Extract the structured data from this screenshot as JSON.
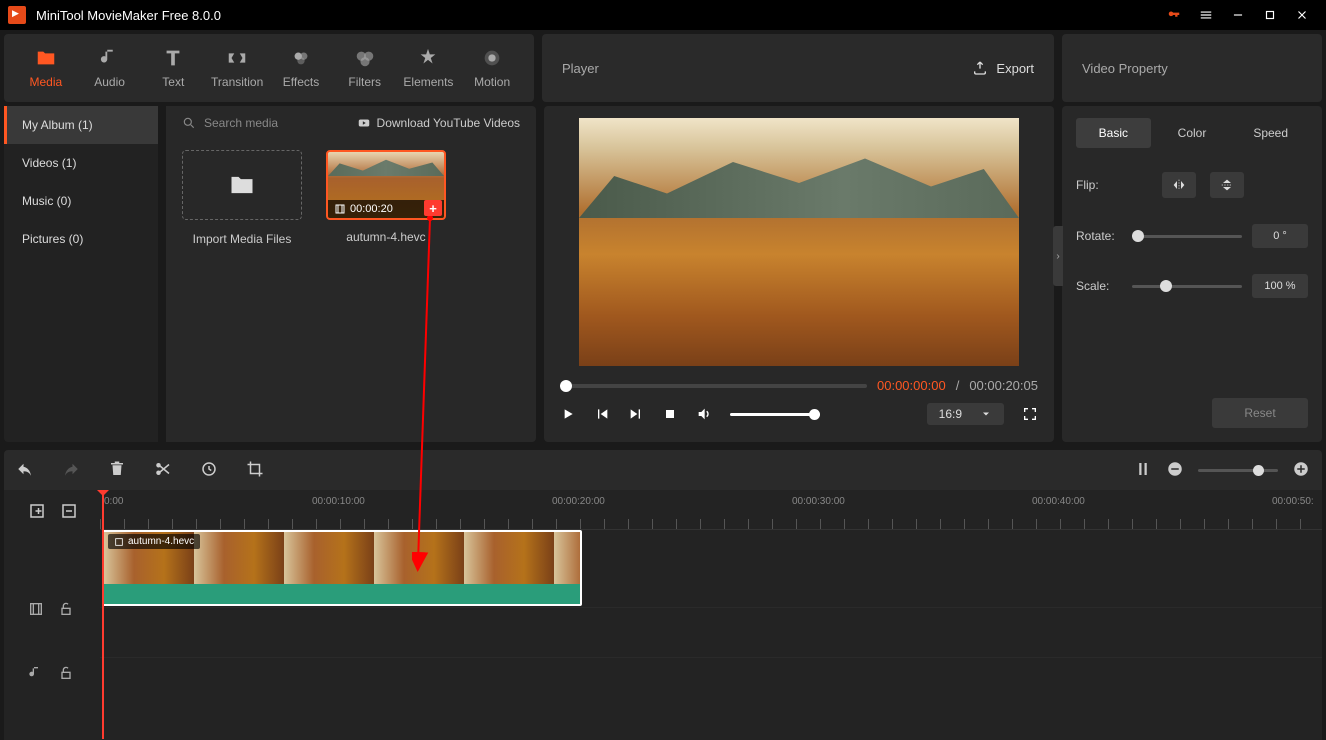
{
  "app": {
    "title": "MiniTool MovieMaker Free 8.0.0"
  },
  "tooltabs": {
    "media": "Media",
    "audio": "Audio",
    "text": "Text",
    "transition": "Transition",
    "effects": "Effects",
    "filters": "Filters",
    "elements": "Elements",
    "motion": "Motion"
  },
  "player": {
    "label": "Player",
    "export": "Export"
  },
  "prop": {
    "label": "Video Property"
  },
  "sidebar": {
    "my_album": "My Album (1)",
    "videos": "Videos (1)",
    "music": "Music (0)",
    "pictures": "Pictures (0)"
  },
  "media": {
    "search_placeholder": "Search media",
    "download": "Download YouTube Videos",
    "import_label": "Import Media Files",
    "clip": {
      "duration": "00:00:20",
      "name": "autumn-4.hevc"
    }
  },
  "playback": {
    "current": "00:00:00:00",
    "sep": " / ",
    "total": "00:00:20:05",
    "aspect": "16:9"
  },
  "prop_panel": {
    "tabs": {
      "basic": "Basic",
      "color": "Color",
      "speed": "Speed"
    },
    "flip": "Flip:",
    "rotate": "Rotate:",
    "rotate_val": "0 °",
    "scale": "Scale:",
    "scale_val": "100 %",
    "reset": "Reset"
  },
  "timeline": {
    "ticks": [
      "0:00",
      "00:00:10:00",
      "00:00:20:00",
      "00:00:30:00",
      "00:00:40:00",
      "00:00:50:"
    ],
    "clip_name": "autumn-4.hevc"
  }
}
